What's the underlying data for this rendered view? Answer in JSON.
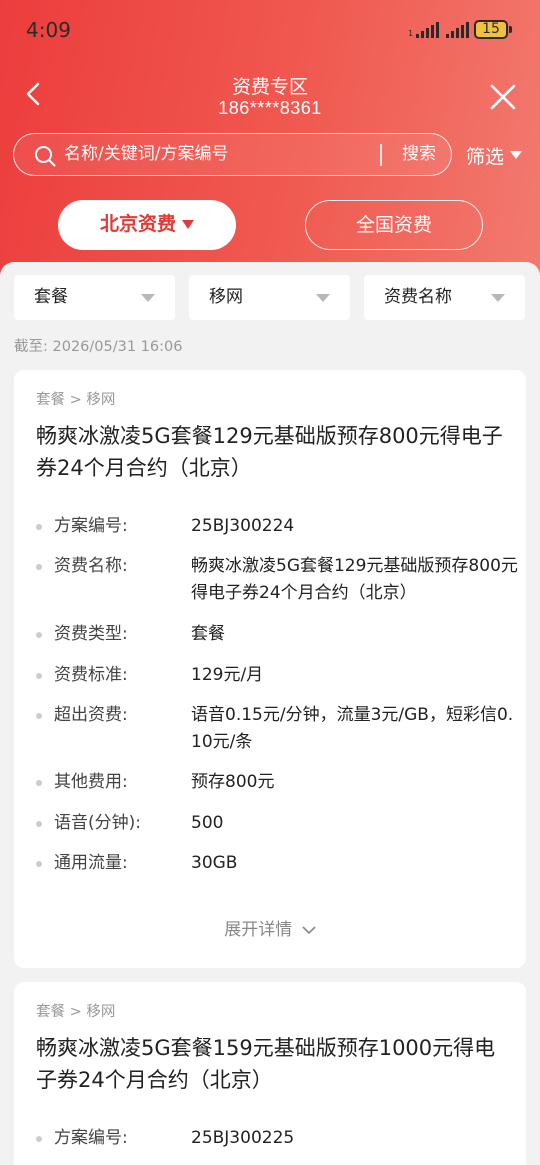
{
  "status": {
    "time": "4:09",
    "battery": "15"
  },
  "nav": {
    "title": "资费专区",
    "phone": "186****8361"
  },
  "search": {
    "placeholder": "名称/关键词/方案编号",
    "button": "搜索",
    "filter": "筛选"
  },
  "region_tabs": [
    {
      "label": "北京资费",
      "active": true
    },
    {
      "label": "全国资费",
      "active": false
    }
  ],
  "filters": [
    {
      "value": "套餐"
    },
    {
      "value": "移网"
    },
    {
      "value": "资费名称"
    }
  ],
  "as_of": "截至:  2026/05/31 16:06",
  "cards": [
    {
      "crumb": "套餐 > 移网",
      "title": "畅爽冰激凌5G套餐129元基础版预存800元得电子券24个月合约（北京）",
      "rows": [
        {
          "label": "方案编号:",
          "value": "25BJ300224"
        },
        {
          "label": "资费名称:",
          "value": "畅爽冰激凌5G套餐129元基础版预存800元得电子券24个月合约（北京）"
        },
        {
          "label": "资费类型:",
          "value": "套餐"
        },
        {
          "label": "资费标准:",
          "value": "129元/月"
        },
        {
          "label": "超出资费:",
          "value": "语音0.15元/分钟，流量3元/GB，短彩信0.10元/条"
        },
        {
          "label": "其他费用:",
          "value": "预存800元"
        },
        {
          "label": "语音(分钟):",
          "value": "500"
        },
        {
          "label": "通用流量:",
          "value": "30GB"
        }
      ],
      "expand": "展开详情"
    },
    {
      "crumb": "套餐 > 移网",
      "title": "畅爽冰激凌5G套餐159元基础版预存1000元得电子券24个月合约（北京）",
      "rows": [
        {
          "label": "方案编号:",
          "value": "25BJ300225"
        }
      ]
    }
  ]
}
